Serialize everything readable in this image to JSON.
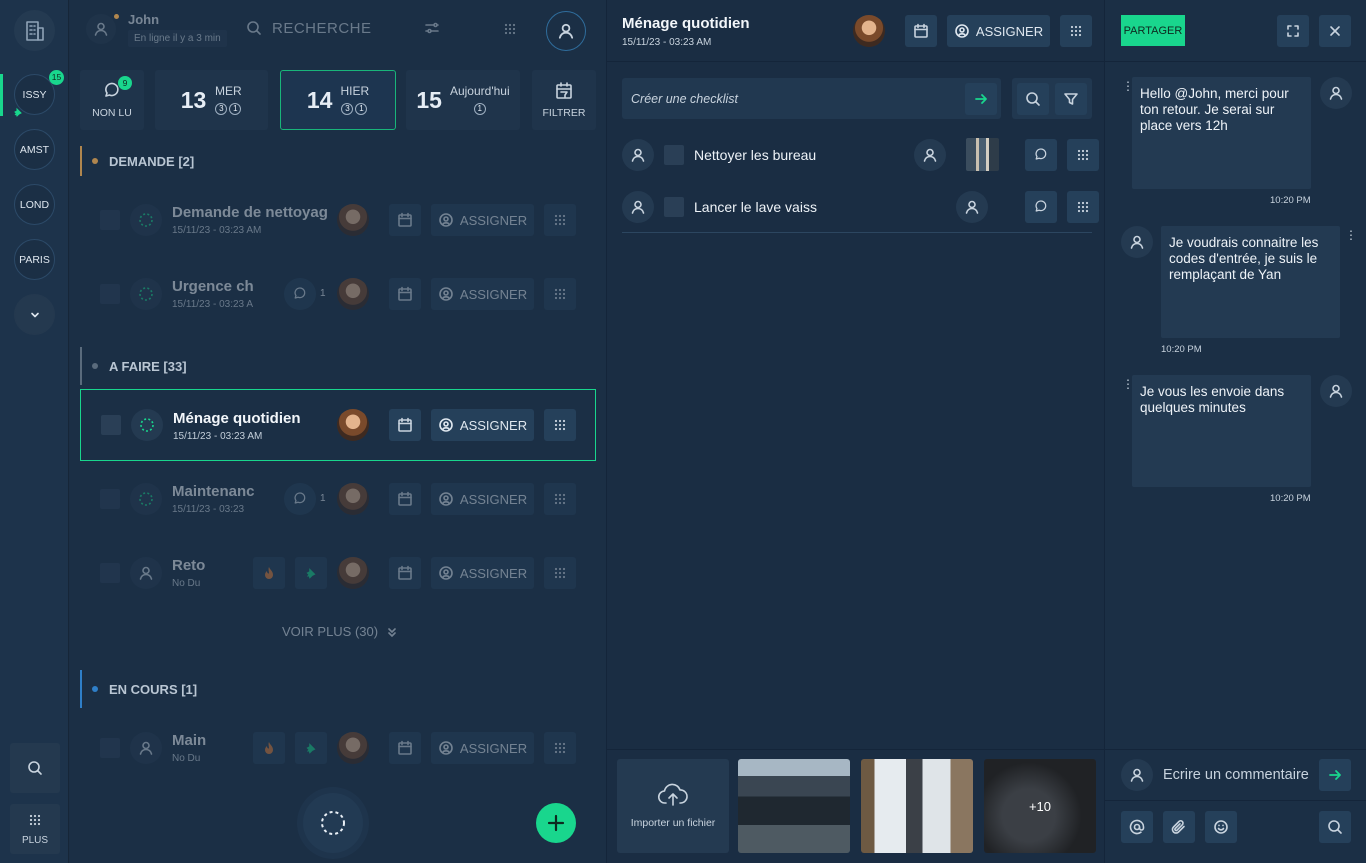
{
  "user": {
    "name": "John",
    "status": "En ligne il y a 3 min"
  },
  "search": {
    "placeholder": "RECHERCHE"
  },
  "locations": [
    {
      "code": "ISSY",
      "badge": "15"
    },
    {
      "code": "AMST"
    },
    {
      "code": "LOND"
    },
    {
      "code": "PARIS"
    }
  ],
  "rail": {
    "more_label": "PLUS"
  },
  "days": {
    "unread": {
      "label": "NON LU",
      "count": "9"
    },
    "items": [
      {
        "num": "13",
        "name": "MER",
        "c1": "3",
        "c2": "1"
      },
      {
        "num": "14",
        "name": "HIER",
        "c1": "3",
        "c2": "1"
      },
      {
        "num": "15",
        "name": "Aujourd'hui",
        "c2": "1"
      }
    ],
    "filter_label": "FILTRER"
  },
  "sections": {
    "demande": "DEMANDE [2]",
    "afaire": "A FAIRE [33]",
    "encours": "EN COURS [1]"
  },
  "tasks": [
    {
      "title": "Demande de nettoyag",
      "date": "15/11/23 - 03:23 AM"
    },
    {
      "title": "Urgence ch",
      "date": "15/11/23 - 03:23 A",
      "comments": "1"
    },
    {
      "title": "Ménage quotidien",
      "date": "15/11/23 - 03:23 AM"
    },
    {
      "title": "Maintenanc",
      "date": "15/11/23 - 03:23",
      "comments": "1"
    },
    {
      "title": "Reto",
      "date": "No Du"
    },
    {
      "title": "Main",
      "date": "No Du"
    }
  ],
  "assign_label": "ASSIGNER",
  "see_more": "VOIR PLUS (30)",
  "detail": {
    "title": "Ménage quotidien",
    "date": "15/11/23 - 03:23 AM",
    "assign_label": "ASSIGNER",
    "checklist_placeholder": "Créer une checklist",
    "checklist": [
      {
        "label": "Nettoyer les bureau"
      },
      {
        "label": "Lancer le lave vaiss"
      }
    ],
    "upload_label": "Importer un fichier",
    "more_photos": "+10"
  },
  "chat": {
    "share_label": "PARTAGER",
    "messages": [
      {
        "text": "Hello @John, merci pour ton retour. Je serai sur place vers 12h",
        "time": "10:20 PM"
      },
      {
        "text": "Je voudrais connaitre les codes d'entrée, je suis le remplaçant de Yan",
        "time": "10:20 PM"
      },
      {
        "text": "Je vous les envoie dans quelques minutes",
        "time": "10:20 PM"
      }
    ],
    "comment_placeholder": "Ecrire un commentaire"
  },
  "colors": {
    "accent": "#19d68d",
    "section_demande": "#b0864e",
    "section_afaire": "#5a6b7c",
    "section_encours": "#2f7fc8"
  }
}
